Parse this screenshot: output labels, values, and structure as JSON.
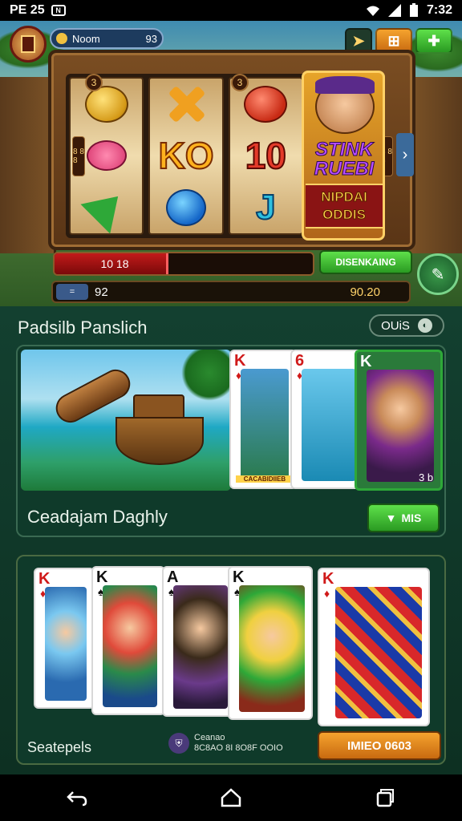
{
  "status_bar": {
    "left_text": "PE 25",
    "nfc_label": "N",
    "time": "7:32"
  },
  "header": {
    "user_name": "Noom",
    "balance": "93",
    "btn_nav_icon": "send-icon",
    "btn_menu_icon": "grid-icon",
    "btn_add_icon": "plus-icon"
  },
  "slot": {
    "reel_badge_1": "3",
    "reel_badge_2": "3",
    "ko_symbol": "KO",
    "ten_symbol": "10",
    "j_symbol": "J",
    "side_badge_left": "8 8 8",
    "side_badge_right": "8 8 8",
    "bonus_title": "STINK RUEBI",
    "bonus_subtitle": "NIPDAI ODDIS",
    "progress_text": "10 18",
    "progress_fraction": 0.44,
    "green_button": "DISENKAING",
    "bottom_left": "92",
    "bottom_right": "90.20",
    "bottom_tag": "=",
    "round_button_icon": "chat-icon"
  },
  "section1": {
    "title": "Padsilb Panslich",
    "filter_label": "OUiS",
    "filter_icon": "toggle-icon",
    "card_caption": "CACABIDIIEB",
    "card_note": "3 b",
    "caption": "Ceadajam Daghly",
    "button_label": "MIS",
    "button_icon": "heart-icon",
    "card_ranks": [
      "K",
      "6",
      "K"
    ]
  },
  "section2": {
    "card_ranks": [
      "K",
      "K",
      "A",
      "K",
      "K"
    ],
    "caption": "Seatepels",
    "mini_icon": "shield-icon",
    "mini_line1": "Ceanao",
    "mini_line2": "8C8AO 8I 8O8F OOIO",
    "button_label": "IMIEO 0603"
  },
  "colors": {
    "accent_green": "#2a9a22",
    "accent_orange": "#e8891e",
    "panel_bg": "#0f3a2a"
  }
}
